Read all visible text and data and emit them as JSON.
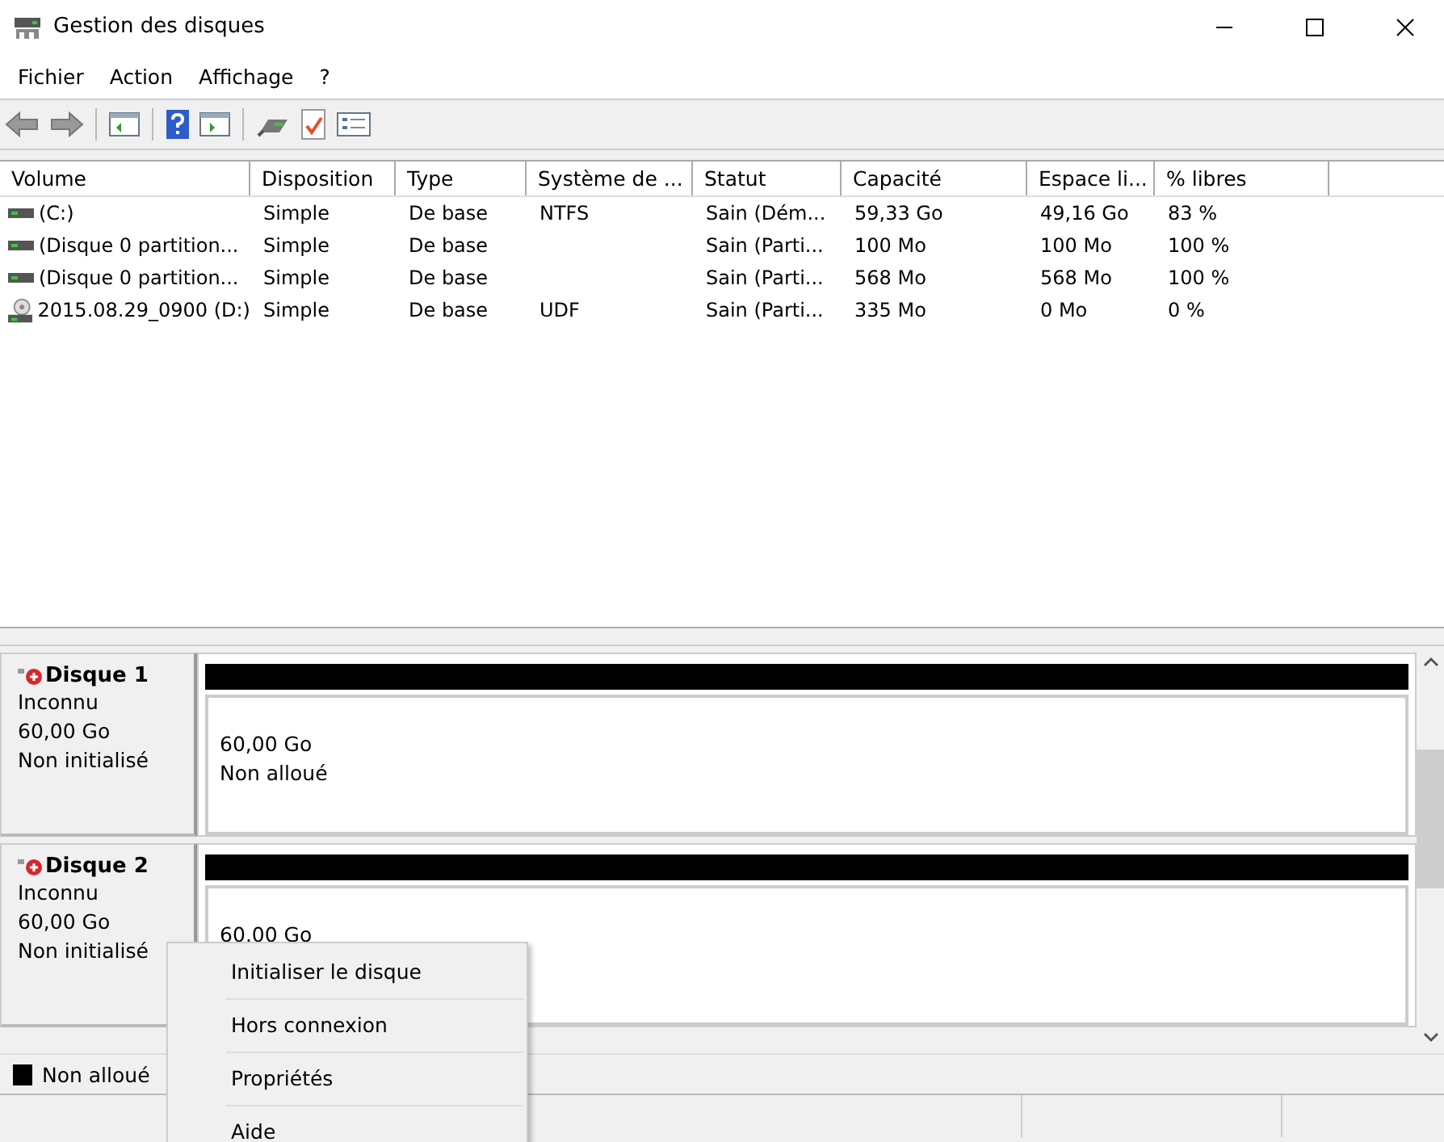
{
  "window": {
    "title": "Gestion des disques"
  },
  "menu": [
    "Fichier",
    "Action",
    "Affichage",
    "?"
  ],
  "table": {
    "columns": [
      "Volume",
      "Disposition",
      "Type",
      "Système de ...",
      "Statut",
      "Capacité",
      "Espace li...",
      "% libres"
    ],
    "rows": [
      {
        "kind": "drive",
        "cells": [
          "(C:)",
          "Simple",
          "De base",
          "NTFS",
          "Sain (Dém...",
          "59,33 Go",
          "49,16 Go",
          "83 %"
        ]
      },
      {
        "kind": "drive",
        "cells": [
          "(Disque 0 partition...",
          "Simple",
          "De base",
          "",
          "Sain (Parti...",
          "100 Mo",
          "100 Mo",
          "100 %"
        ]
      },
      {
        "kind": "drive",
        "cells": [
          "(Disque 0 partition...",
          "Simple",
          "De base",
          "",
          "Sain (Parti...",
          "568 Mo",
          "568 Mo",
          "100 %"
        ]
      },
      {
        "kind": "optical",
        "cells": [
          "2015.08.29_0900 (D:)",
          "Simple",
          "De base",
          "UDF",
          "Sain (Parti...",
          "335 Mo",
          "0 Mo",
          "0 %"
        ]
      }
    ]
  },
  "disks": [
    {
      "name": "Disque 1",
      "type": "Inconnu",
      "size": "60,00 Go",
      "status": "Non initialisé",
      "partition": {
        "size": "60,00 Go",
        "status": "Non alloué"
      }
    },
    {
      "name": "Disque 2",
      "type": "Inconnu",
      "size": "60,00 Go",
      "status": "Non initialisé",
      "partition": {
        "size": "60,00 Go"
      }
    }
  ],
  "legend": [
    {
      "label": "Non alloué",
      "color": "#000000"
    }
  ],
  "context_menu": [
    "Initialiser le disque",
    "Hors connexion",
    "Propriétés",
    "Aide"
  ]
}
